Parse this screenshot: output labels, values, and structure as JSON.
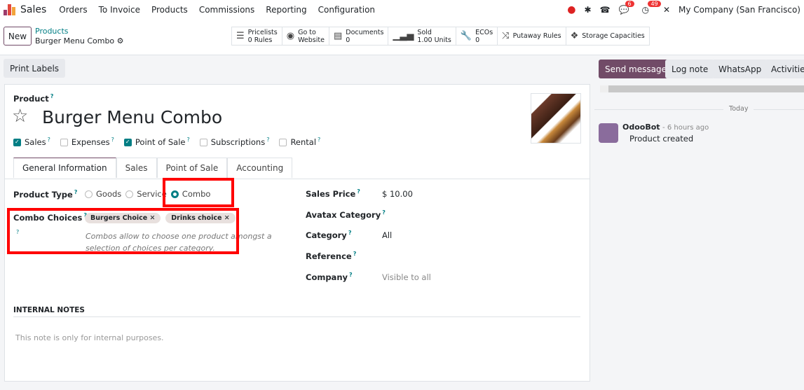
{
  "nav": {
    "app": "Sales",
    "menu": [
      "Orders",
      "To Invoice",
      "Products",
      "Commissions",
      "Reporting",
      "Configuration"
    ],
    "messages_count": "6",
    "activities_count": "49",
    "company": "My Company (San Francisco)"
  },
  "control": {
    "new_label": "New",
    "breadcrumb_parent": "Products",
    "breadcrumb_current": "Burger Menu Combo",
    "stats": [
      {
        "icon": "list-icon",
        "l1": "Pricelists",
        "l2": "0 Rules"
      },
      {
        "icon": "globe-icon",
        "l1": "Go to",
        "l2": "Website"
      },
      {
        "icon": "document-icon",
        "l1": "Documents",
        "l2": "0"
      },
      {
        "icon": "bar-chart-icon",
        "l1": "Sold",
        "l2": "1.00 Units"
      },
      {
        "icon": "wrench-icon",
        "l1": "ECOs",
        "l2": "0"
      },
      {
        "icon": "shuffle-icon",
        "l1": "Putaway Rules",
        "l2": ""
      },
      {
        "icon": "cubes-icon",
        "l1": "Storage Capacities",
        "l2": ""
      }
    ]
  },
  "actions": {
    "print_labels": "Print Labels",
    "send_message": "Send message",
    "log_note": "Log note",
    "whatsapp": "WhatsApp",
    "activities": "Activities"
  },
  "form": {
    "product_label": "Product",
    "name": "Burger Menu Combo",
    "checks": [
      {
        "label": "Sales",
        "checked": true
      },
      {
        "label": "Expenses",
        "checked": false
      },
      {
        "label": "Point of Sale",
        "checked": true
      },
      {
        "label": "Subscriptions",
        "checked": false
      },
      {
        "label": "Rental",
        "checked": false
      }
    ],
    "tabs": [
      "General Information",
      "Sales",
      "Point of Sale",
      "Accounting"
    ],
    "product_type_label": "Product Type",
    "types": [
      "Goods",
      "Service",
      "Combo"
    ],
    "selected_type": "Combo",
    "combo_label": "Combo Choices",
    "combo_tags": [
      "Burgers Choice",
      "Drinks choice"
    ],
    "combo_help": "Combos allow to choose one product amongst a selection of choices per category.",
    "right_fields": [
      {
        "label": "Sales Price",
        "value": "$ 10.00"
      },
      {
        "label": "Avatax Category",
        "value": ""
      },
      {
        "label": "Category",
        "value": "All"
      },
      {
        "label": "Reference",
        "value": ""
      },
      {
        "label": "Company",
        "value": "Visible to all"
      }
    ],
    "notes_title": "INTERNAL NOTES",
    "notes_placeholder": "This note is only for internal purposes."
  },
  "chatter": {
    "today": "Today",
    "author": "OdooBot",
    "time": "- 6 hours ago",
    "message": "Product created"
  }
}
